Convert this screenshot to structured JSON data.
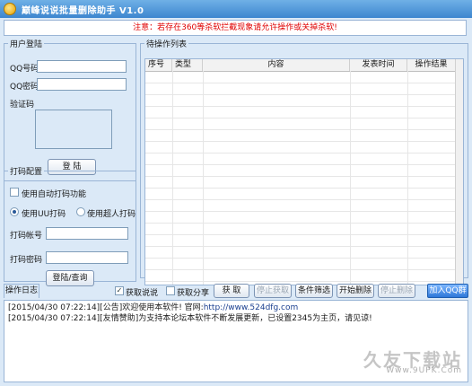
{
  "window": {
    "title": "巅峰说说批量删除助手  V1.0"
  },
  "notice": "注意：若存在360等杀软拦截现象请允许操作或关掉杀软!",
  "login": {
    "legend": "用户登陆",
    "qq_label": "QQ号码",
    "qq_value": "",
    "pwd_label": "QQ密码",
    "pwd_value": "",
    "captcha_label": "验证码",
    "login_button": "登  陆"
  },
  "captcha_service": {
    "legend": "打码配置",
    "auto_label": "使用自动打码功能",
    "auto_checked": false,
    "radio_uu": "使用UU打码",
    "radio_super": "使用超人打码",
    "selected": "uu",
    "account_label": "打码帐号",
    "account_value": "",
    "password_label": "打码密码",
    "password_value": "",
    "login_query_button": "登陆/查询"
  },
  "list": {
    "legend": "待操作列表",
    "columns": [
      "序号",
      "类型",
      "内容",
      "发表时间",
      "操作结果"
    ]
  },
  "toolbar": {
    "log_tab": "操作日志",
    "fetch_shuoshuo": "获取说说",
    "fetch_shuoshuo_checked": true,
    "fetch_share": "获取分享",
    "fetch_share_checked": false,
    "fetch_button": "获  取",
    "stop_fetch_button": "停止获取",
    "filter_button": "条件筛选",
    "start_delete_button": "开始删除",
    "stop_delete_button": "停止删除",
    "join_qq_group": "加入QQ群"
  },
  "log": {
    "lines": [
      {
        "prefix": "[2015/04/30 07:22:14][公告]欢迎使用本软件! 官网:",
        "url": "http://www.524dfg.com"
      },
      {
        "prefix": "[2015/04/30 07:22:14][友情赞助]为支持本论坛本软件不断发展更新，已设置2345为主页，请见谅!",
        "url": ""
      }
    ]
  },
  "watermark": {
    "big": "久友下载站",
    "small": "Www.9UPK.Com"
  }
}
